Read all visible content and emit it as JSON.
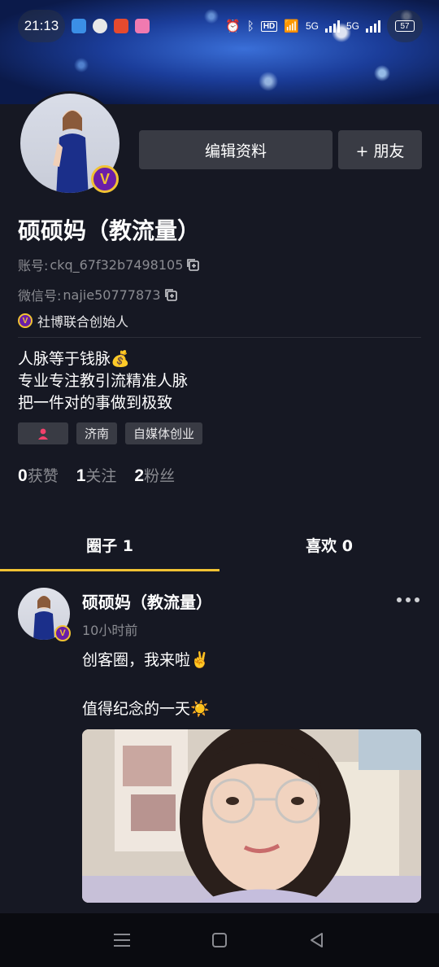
{
  "status_bar": {
    "time": "21:13",
    "hd_label": "HD",
    "network_1": "5G",
    "network_2": "5G",
    "battery": "57"
  },
  "profile": {
    "edit_button": "编辑资料",
    "friend_button": "+ 朋友",
    "name": "硕硕妈（教流量）",
    "account_label": "账号: ",
    "account_value": "ckq_67f32b7498105",
    "wechat_label": "微信号: ",
    "wechat_value": "najie50777873",
    "certification": "社博联合创始人",
    "bio_lines": [
      "人脉等于钱脉💰",
      "专业专注教引流精准人脉",
      "把一件对的事做到极致"
    ],
    "tags": [
      "济南",
      "自媒体创业"
    ],
    "gender_tag_color": "#f2416b",
    "stats": [
      {
        "num": "0",
        "label": "获赞"
      },
      {
        "num": "1",
        "label": "关注"
      },
      {
        "num": "2",
        "label": "粉丝"
      }
    ]
  },
  "tabs": [
    {
      "label": "圈子 1",
      "active": true
    },
    {
      "label": "喜欢 0",
      "active": false
    }
  ],
  "post": {
    "author": "硕硕妈（教流量）",
    "time": "10小时前",
    "text": "创客圈，我来啦✌️\n\n值得纪念的一天☀️"
  },
  "colors": {
    "background": "#161823",
    "button": "#393b44",
    "accent": "#f1c233",
    "badge": "#6a1ea8",
    "muted_text": "#8a8b91"
  },
  "icons": {
    "verified": "v-badge-icon",
    "copy": "copy-icon",
    "more": "more-dots-icon",
    "nav": [
      "menu-icon",
      "home-square-icon",
      "back-triangle-icon"
    ]
  }
}
